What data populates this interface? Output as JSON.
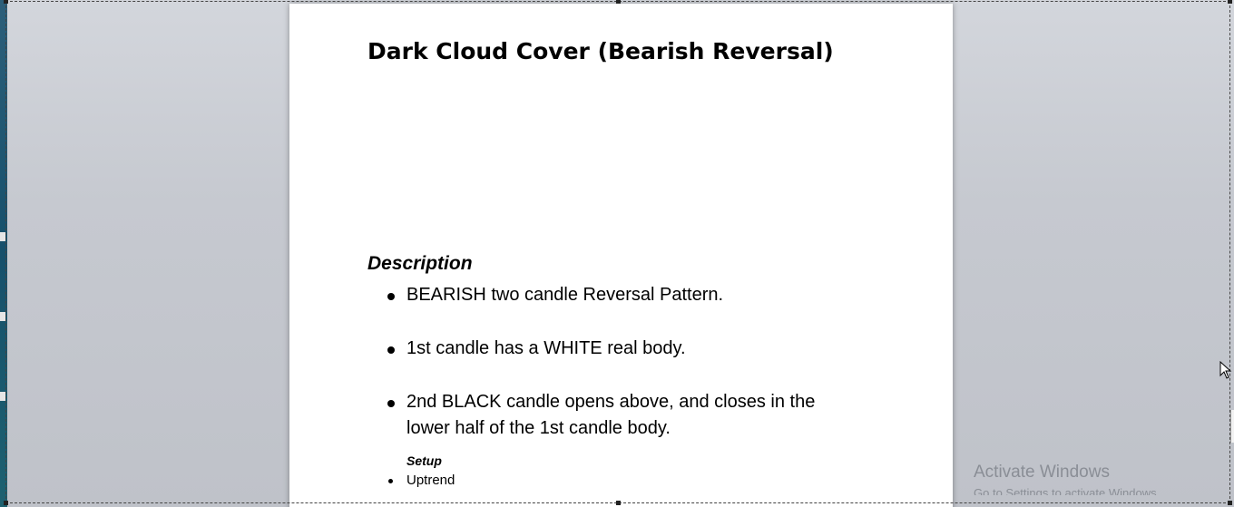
{
  "document": {
    "title": "Dark Cloud Cover (Bearish Reversal)",
    "description_heading": "Description",
    "bullets": [
      "BEARISH two candle Reversal Pattern.",
      "1st candle has a WHITE real body.",
      "2nd BLACK candle opens above, and closes in the lower half of the 1st candle body."
    ],
    "setup_heading": "Setup",
    "setup_items": [
      "Uptrend"
    ]
  },
  "watermark": {
    "title": "Activate Windows",
    "subtitle": "Go to Settings to activate Windows."
  },
  "icons": {
    "cursor": "mouse-pointer-icon",
    "bullet": "bullet-dot-icon"
  },
  "colors": {
    "page": "#ffffff",
    "workspace": "#c9ccd3",
    "text": "#000000",
    "left_strip": "#1d5a72"
  }
}
